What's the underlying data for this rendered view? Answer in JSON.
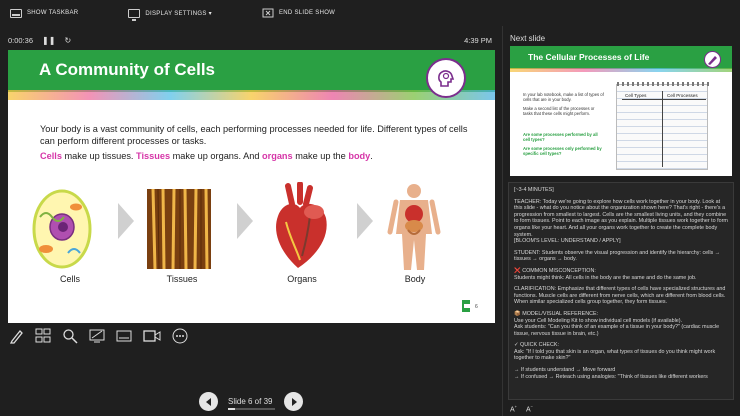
{
  "toolbar": {
    "show_taskbar": "SHOW TASKBAR",
    "display_settings": "DISPLAY SETTINGS ▾",
    "end_slide_show": "END SLIDE SHOW"
  },
  "timer": {
    "elapsed": "0:00:36",
    "clock": "4:39 PM"
  },
  "slide": {
    "title": "A Community of Cells",
    "para1": "Your body is a vast community of cells, each performing processes needed for life. Different types of cells can perform different processes or tasks.",
    "line2": {
      "w1": "Cells",
      "t1": " make up tissues.  ",
      "w2": "Tissues",
      "t2": " make up organs. And ",
      "w3": "organs",
      "t3": " make up the ",
      "w4": "body",
      "t4": "."
    },
    "labels": [
      "Cells",
      "Tissues",
      "Organs",
      "Body"
    ],
    "page_mark": "6"
  },
  "navigation": {
    "slide_counter": "Slide 6 of 39",
    "progress": 0.154
  },
  "next": {
    "label": "Next slide",
    "title": "The Cellular Processes of Life",
    "text1": "In your lab notebook, make a list of types of cells that are in your body.",
    "text2": "Make a second list of the processes or tasks that these cells might perform.",
    "text3": "Are some processes performed by all cell types?",
    "text4": "Are some processes only performed by specific cell types?",
    "col1": "Cell Types",
    "col2": "Cell Processes"
  },
  "notes": [
    "[~3-4 MINUTES]",
    "TEACHER: Today we're going to explore how cells work together in your body. Look at this slide - what do you notice about the organization shown here? That's right - there's a progression from smallest to largest. Cells are the smallest living units, and they combine to form tissues. Point to each image as you explain. Multiple tissues work together to form organs like your heart. And all your organs work together to create the complete body system.\n[BLOOM'S LEVEL: UNDERSTAND / APPLY]",
    "STUDENT: Students observe the visual progression and identify the hierarchy: cells → tissues → organs → body.",
    "❌ COMMON MISCONCEPTION:\nStudents might think: All cells in the body are the same and do the same job.",
    "CLARIFICATION: Emphasize that different types of cells have specialized structures and functions. Muscle cells are different from nerve cells, which are different from blood cells. When similar specialized cells group together, they form tissues.",
    "📦 MODEL/VISUAL REFERENCE:\nUse your Cell Modeling Kit to show individual cell models (if available).\nAsk students: \"Can you think of an example of a tissue in your body?\" (cardiac muscle tissue, nervous tissue in brain, etc.)",
    "✓ QUICK CHECK:\nAsk: \"If I told you that skin is an organ, what types of tissues do you think might work together to make skin?\"",
    "    → If students understand → Move forward\n    → If confused → Reteach using analogies: \"Think of tissues like different workers"
  ]
}
